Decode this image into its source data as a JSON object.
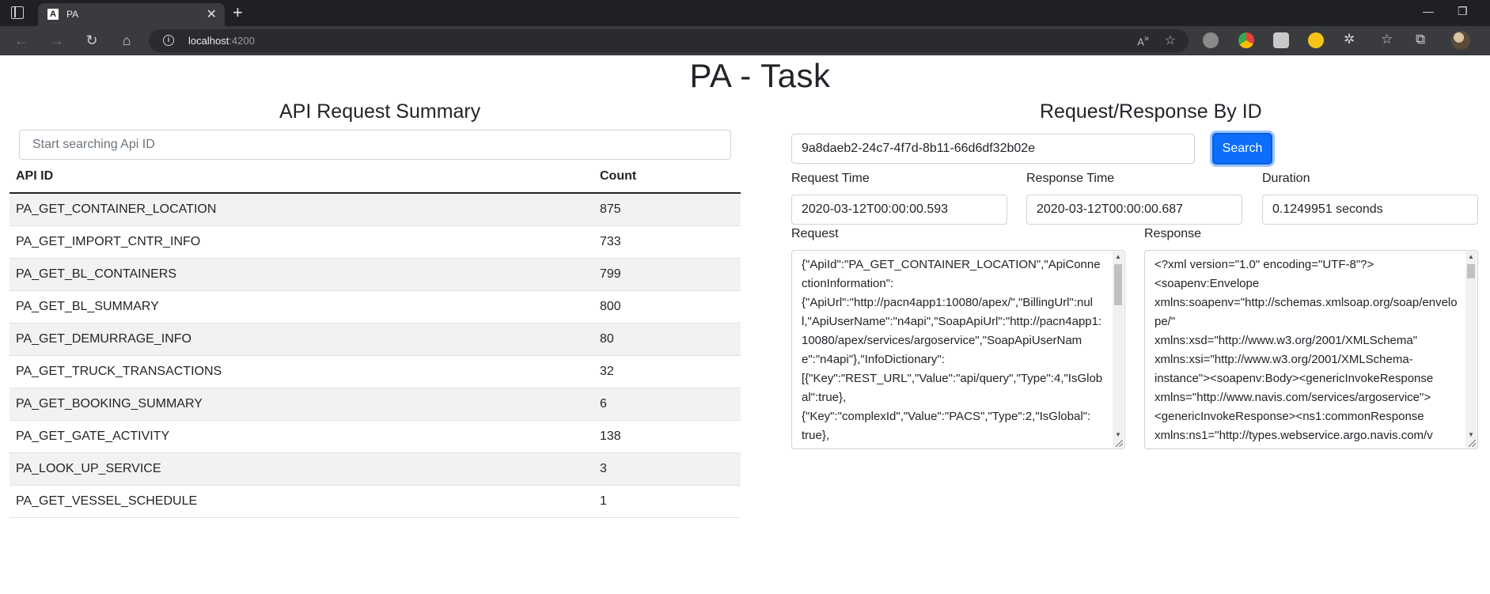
{
  "browser": {
    "tab_title": "PA",
    "tab_favicon_letter": "A",
    "url_host": "localhost",
    "url_port": ":4200"
  },
  "page": {
    "title": "PA - Task"
  },
  "summary": {
    "heading": "API Request Summary",
    "search_placeholder": "Start searching Api ID",
    "columns": [
      "API ID",
      "Count"
    ],
    "rows": [
      {
        "api_id": "PA_GET_CONTAINER_LOCATION",
        "count": "875"
      },
      {
        "api_id": "PA_GET_IMPORT_CNTR_INFO",
        "count": "733"
      },
      {
        "api_id": "PA_GET_BL_CONTAINERS",
        "count": "799"
      },
      {
        "api_id": "PA_GET_BL_SUMMARY",
        "count": "800"
      },
      {
        "api_id": "PA_GET_DEMURRAGE_INFO",
        "count": "80"
      },
      {
        "api_id": "PA_GET_TRUCK_TRANSACTIONS",
        "count": "32"
      },
      {
        "api_id": "PA_GET_BOOKING_SUMMARY",
        "count": "6"
      },
      {
        "api_id": "PA_GET_GATE_ACTIVITY",
        "count": "138"
      },
      {
        "api_id": "PA_LOOK_UP_SERVICE",
        "count": "3"
      },
      {
        "api_id": "PA_GET_VESSEL_SCHEDULE",
        "count": "1"
      }
    ]
  },
  "detail": {
    "heading": "Request/Response By ID",
    "id_value": "9a8daeb2-24c7-4f7d-8b11-66d6df32b02e",
    "search_label": "Search",
    "request_time_label": "Request Time",
    "request_time_value": "2020-03-12T00:00:00.593",
    "response_time_label": "Response Time",
    "response_time_value": "2020-03-12T00:00:00.687",
    "duration_label": "Duration",
    "duration_value": "0.1249951 seconds",
    "request_label": "Request",
    "request_text": "{\"ApiId\":\"PA_GET_CONTAINER_LOCATION\",\"ApiConnectionInformation\":\n{\"ApiUrl\":\"http://pacn4app1:10080/apex/\",\"BillingUrl\":null,\"ApiUserName\":\"n4api\",\"SoapApiUrl\":\"http://pacn4app1:10080/apex/services/argoservice\",\"SoapApiUserName\":\"n4api\"},\"InfoDictionary\":\n[{\"Key\":\"REST_URL\",\"Value\":\"api/query\",\"Type\":4,\"IsGlobal\":true},\n{\"Key\":\"complexId\",\"Value\":\"PACS\",\"Type\":2,\"IsGlobal\":\ntrue},",
    "response_label": "Response",
    "response_text": "<?xml version=\"1.0\" encoding=\"UTF-8\"?>\n<soapenv:Envelope\nxmlns:soapenv=\"http://schemas.xmlsoap.org/soap/envelope/\"\nxmlns:xsd=\"http://www.w3.org/2001/XMLSchema\"\nxmlns:xsi=\"http://www.w3.org/2001/XMLSchema-\ninstance\"><soapenv:Body><genericInvokeResponse\nxmlns=\"http://www.navis.com/services/argoservice\">\n<genericInvokeResponse><ns1:commonResponse\nxmlns:ns1=\"http://types.webservice.argo.navis.com/v"
  }
}
